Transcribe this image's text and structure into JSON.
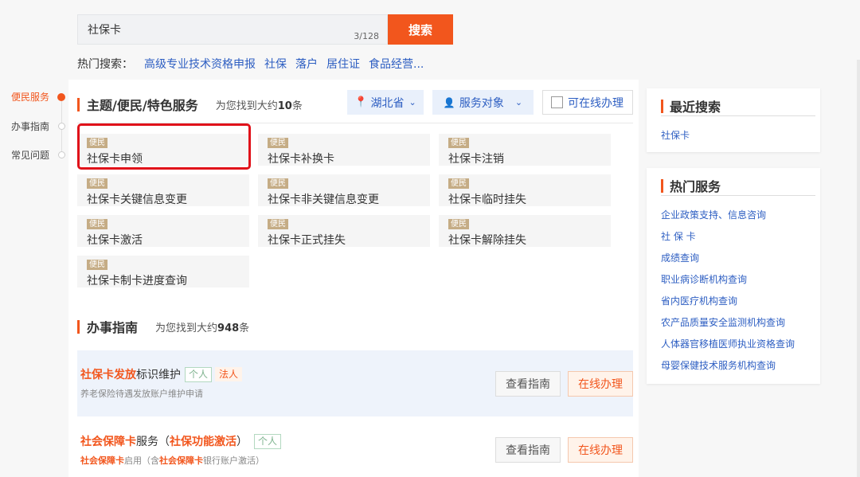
{
  "search": {
    "value": "社保卡",
    "count": "3/128",
    "button": "搜索"
  },
  "hot": {
    "label": "热门搜索：",
    "keywords": [
      "高级专业技术资格申报",
      "社保",
      "落户",
      "居住证",
      "食品经营..."
    ]
  },
  "sidenav": [
    {
      "label": "便民服务",
      "active": true
    },
    {
      "label": "办事指南",
      "active": false
    },
    {
      "label": "常见问题",
      "active": false
    }
  ],
  "services": {
    "title": "主题/便民/特色服务",
    "found_prefix": "为您找到大约",
    "found_count": "10",
    "found_suffix": "条",
    "filters": {
      "region": "湖北省",
      "target": "服务对象",
      "online": "可在线办理"
    },
    "tiles": [
      {
        "tag": "便民",
        "name": "社保卡申领"
      },
      {
        "tag": "便民",
        "name": "社保卡补换卡"
      },
      {
        "tag": "便民",
        "name": "社保卡注销"
      },
      {
        "tag": "便民",
        "name": "社保卡关键信息变更"
      },
      {
        "tag": "便民",
        "name": "社保卡非关键信息变更"
      },
      {
        "tag": "便民",
        "name": "社保卡临时挂失"
      },
      {
        "tag": "便民",
        "name": "社保卡激活"
      },
      {
        "tag": "便民",
        "name": "社保卡正式挂失"
      },
      {
        "tag": "便民",
        "name": "社保卡解除挂失"
      },
      {
        "tag": "便民",
        "name": "社保卡制卡进度查询"
      }
    ]
  },
  "guide": {
    "title": "办事指南",
    "found_prefix": "为您找到大约",
    "found_count": "948",
    "found_suffix": "条",
    "items": [
      {
        "title_hl": "社保卡发放",
        "title_rest": "标识维护",
        "badge1": "个人",
        "badge2": "法人",
        "sub": "养老保险待遇发放账户维护申请",
        "btn_guide": "查看指南",
        "btn_online": "在线办理"
      },
      {
        "title_hl1": "社会保障卡",
        "title_mid": "服务（",
        "title_hl2": "社保功能激活",
        "title_end": "）",
        "badge1": "个人",
        "sub_hl1": "社会保障卡",
        "sub_mid": "启用（含",
        "sub_hl2": "社会保障卡",
        "sub_end": "银行账户激活）",
        "btn_guide": "查看指南",
        "btn_online": "在线办理"
      }
    ]
  },
  "recent": {
    "title": "最近搜索",
    "items": [
      "社保卡"
    ]
  },
  "popular": {
    "title": "热门服务",
    "items": [
      "企业政策支持、信息咨询",
      "社 保 卡",
      "成绩查询",
      "职业病诊断机构查询",
      "省内医疗机构查询",
      "农产品质量安全监测机构查询",
      "人体器官移植医师执业资格查询",
      "母婴保健技术服务机构查询"
    ]
  },
  "colors": {
    "accent": "#f2561d",
    "link": "#2d5ec2",
    "highlight_box": "#e0121a"
  }
}
